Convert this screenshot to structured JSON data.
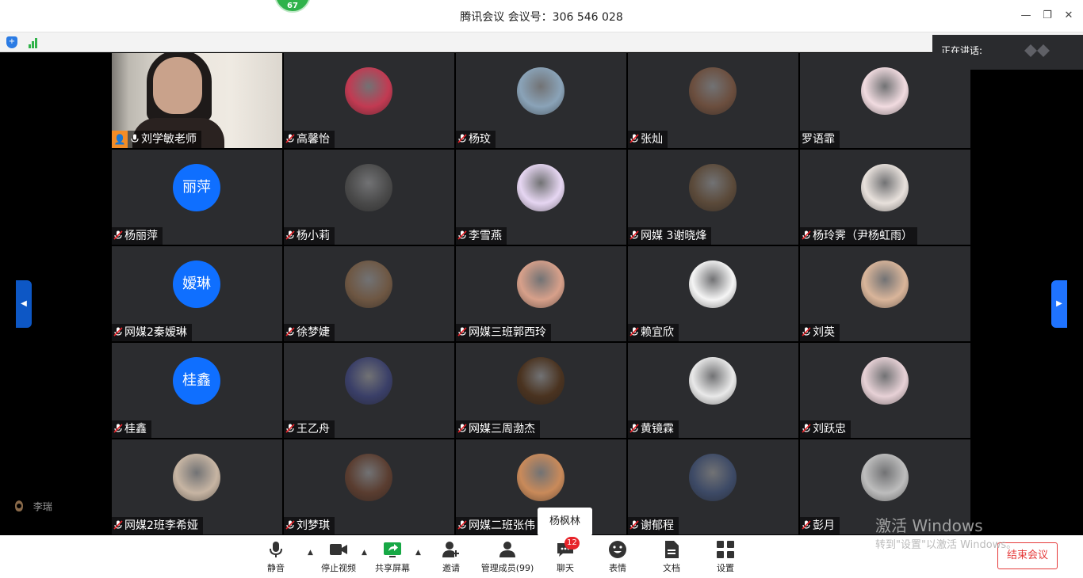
{
  "window": {
    "title": "腾讯会议 会议号：306 546 028",
    "badge": "67"
  },
  "speaking": {
    "label": "正在讲话:"
  },
  "tiles": [
    {
      "name": "刘学敏老师",
      "kind": "video",
      "host": true,
      "mic": "on"
    },
    {
      "name": "高馨怡",
      "kind": "photo",
      "color": "#c23a52",
      "mic": "muted"
    },
    {
      "name": "杨玟",
      "kind": "photo",
      "color": "#8aa3b8",
      "mic": "muted"
    },
    {
      "name": "张灿",
      "kind": "photo",
      "color": "#6b4e3e",
      "mic": "muted"
    },
    {
      "name": "罗语霏",
      "kind": "photo",
      "color": "#f1dbe0",
      "mic": "none"
    },
    {
      "name": "杨丽萍",
      "kind": "text",
      "avatar_text": "丽萍",
      "mic": "muted"
    },
    {
      "name": "杨小莉",
      "kind": "photo",
      "color": "#4a4a4a",
      "mic": "muted"
    },
    {
      "name": "李雪燕",
      "kind": "photo",
      "color": "#e6d6f2",
      "mic": "muted"
    },
    {
      "name": "网媒 3谢晓烽",
      "kind": "photo",
      "color": "#5b4a3a",
      "mic": "muted"
    },
    {
      "name": "杨玲霁（尹杨虹雨）",
      "kind": "photo",
      "color": "#e8e1dc",
      "mic": "muted"
    },
    {
      "name": "网媒2秦嫒琳",
      "kind": "text",
      "avatar_text": "嫒琳",
      "mic": "muted"
    },
    {
      "name": "徐梦婕",
      "kind": "photo",
      "color": "#6e5743",
      "mic": "muted"
    },
    {
      "name": "网媒三班郭西玲",
      "kind": "photo",
      "color": "#d7a08a",
      "mic": "muted"
    },
    {
      "name": "赖宜欣",
      "kind": "photo",
      "color": "#f5f5f5",
      "mic": "muted"
    },
    {
      "name": "刘英",
      "kind": "photo",
      "color": "#d9b59a",
      "mic": "muted"
    },
    {
      "name": "桂鑫",
      "kind": "text",
      "avatar_text": "桂鑫",
      "mic": "muted"
    },
    {
      "name": "王乙舟",
      "kind": "photo",
      "color": "#3a3f68",
      "mic": "muted"
    },
    {
      "name": "网媒三周渤杰",
      "kind": "photo",
      "color": "#4a3320",
      "mic": "muted"
    },
    {
      "name": "黄镜霖",
      "kind": "photo",
      "color": "#e9e9e9",
      "mic": "muted"
    },
    {
      "name": "刘跃忠",
      "kind": "photo",
      "color": "#e7d1d6",
      "mic": "muted"
    },
    {
      "name": "网媒2班李希娅",
      "kind": "photo",
      "color": "#c7b5a3",
      "mic": "muted"
    },
    {
      "name": "刘梦琪",
      "kind": "photo",
      "color": "#5a3d30",
      "mic": "muted"
    },
    {
      "name": "网媒二班张伟",
      "kind": "photo",
      "color": "#c98a5a",
      "mic": "muted"
    },
    {
      "name": "谢郁程",
      "kind": "photo",
      "color": "#3d4a66",
      "mic": "muted"
    },
    {
      "name": "彭月",
      "kind": "photo",
      "color": "#bdbdbd",
      "mic": "muted"
    }
  ],
  "tooltip": "杨枫林",
  "self_user": "李瑞",
  "toolbar": {
    "mute": "静音",
    "stop_video": "停止视频",
    "share_screen": "共享屏幕",
    "invite": "邀请",
    "manage_members": "管理成员(99)",
    "chat": "聊天",
    "chat_badge": "12",
    "reaction": "表情",
    "docs": "文档",
    "settings": "设置",
    "end": "结束会议"
  },
  "watermark": {
    "line1": "激活 Windows",
    "line2": "转到\"设置\"以激活 Windows。"
  },
  "colors": {
    "accent": "#1f73ff",
    "end": "#e53a3a",
    "host": "#f28c27",
    "badge": "#e7242a",
    "tile_bg": "#2b2c2f"
  }
}
